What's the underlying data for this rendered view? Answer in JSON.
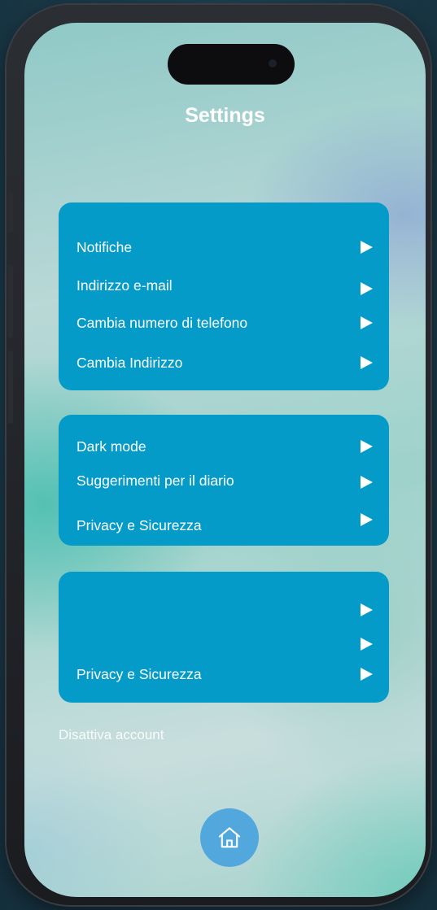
{
  "header": {
    "title": "Settings"
  },
  "section1": {
    "items": [
      {
        "label": "Notifiche"
      },
      {
        "label": "Indirizzo e-mail"
      },
      {
        "label": "Cambia numero di telefono"
      },
      {
        "label": "Cambia Indirizzo"
      }
    ]
  },
  "section2": {
    "items": [
      {
        "label": "Dark mode"
      },
      {
        "label": "Suggerimenti per il diario"
      },
      {
        "label": "Privacy e Sicurezza"
      }
    ]
  },
  "section3": {
    "items": [
      {
        "label": ""
      },
      {
        "label": ""
      },
      {
        "label": "Privacy e Sicurezza"
      }
    ]
  },
  "footer": {
    "deactivate_label": "Disattiva account"
  },
  "nav": {
    "home_icon": "home-icon"
  },
  "colors": {
    "card": "#049bc9",
    "home_button": "#52a8dd",
    "text": "#ffffff"
  }
}
